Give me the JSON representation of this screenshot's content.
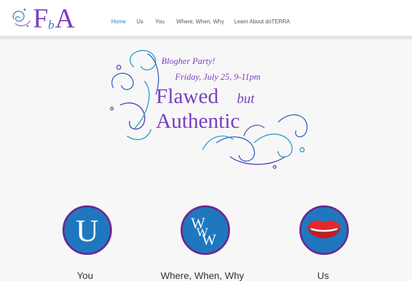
{
  "header": {
    "logo_text": "FbA",
    "nav": [
      {
        "label": "Home",
        "active": true
      },
      {
        "label": "Us",
        "active": false
      },
      {
        "label": "You",
        "active": false
      },
      {
        "label": "Where, When, Why",
        "active": false
      },
      {
        "label": "Learn About doTERRA",
        "active": false
      }
    ]
  },
  "hero": {
    "line1": "Blogher Party!",
    "line2": "Friday, July 25, 9-11pm",
    "title_word1": "Flawed",
    "title_but": "but",
    "title_word2": "Authentic"
  },
  "features": [
    {
      "icon": "U",
      "icon_name": "u-letter-icon",
      "caption": "You"
    },
    {
      "icon": "WWW",
      "icon_name": "www-letters-icon",
      "caption": "Where, When, Why"
    },
    {
      "icon": "lips",
      "icon_name": "red-lips-icon",
      "caption": "Us"
    }
  ],
  "colors": {
    "nav_active": "#2f7fb8",
    "brand_purple": "#6a2c8f",
    "circle_blue": "#1f78bf"
  }
}
